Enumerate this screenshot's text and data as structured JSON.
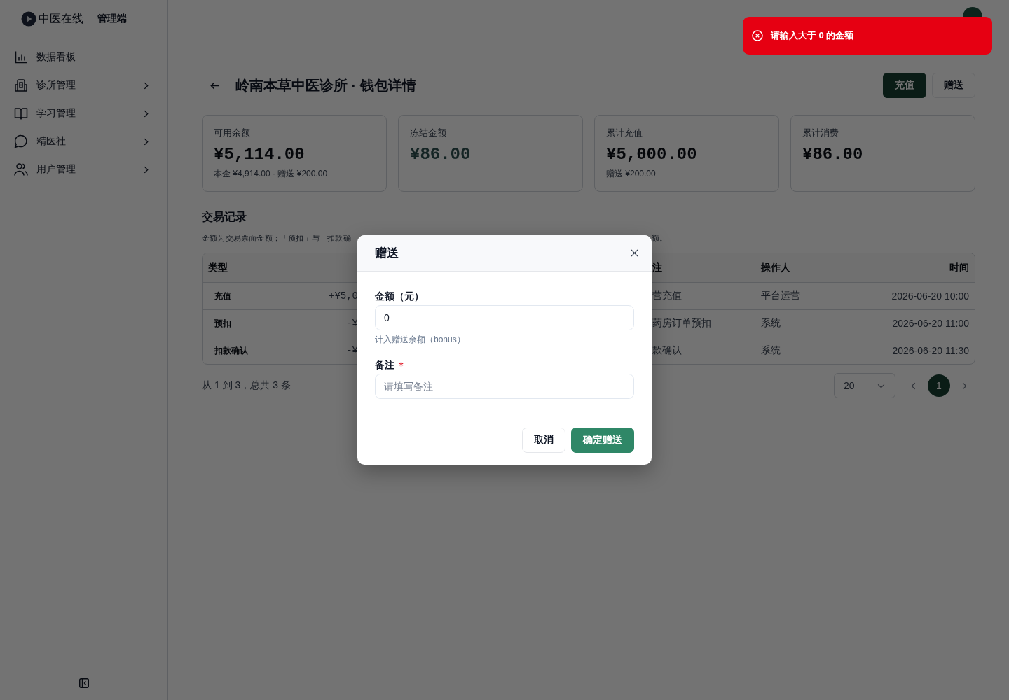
{
  "header": {
    "logo_text": "中医在线",
    "app_label": "管理端"
  },
  "sidebar": {
    "items": [
      {
        "label": "数据看板",
        "has_submenu": false
      },
      {
        "label": "诊所管理",
        "has_submenu": true
      },
      {
        "label": "学习管理",
        "has_submenu": true
      },
      {
        "label": "精医社",
        "has_submenu": true
      },
      {
        "label": "用户管理",
        "has_submenu": true
      }
    ]
  },
  "page": {
    "title": "岭南本草中医诊所 · 钱包详情",
    "actions": [
      {
        "label": "充值",
        "kind": "primary"
      },
      {
        "label": "赠送",
        "kind": "outline"
      }
    ]
  },
  "stats": [
    {
      "label": "可用余额",
      "value": "¥5,114.00",
      "note": "本金 ¥4,914.00 · 赠送 ¥200.00",
      "muted": false
    },
    {
      "label": "冻结金额",
      "value": "¥86.00",
      "muted": true
    },
    {
      "label": "累计充值",
      "value": "¥5,000.00",
      "note": "赠送 ¥200.00",
      "muted": false
    },
    {
      "label": "累计消费",
      "value": "¥86.00",
      "muted": false
    }
  ],
  "transactions": {
    "title": "交易记录",
    "note_left": "金额为交易票面金额；「预扣」与「扣款确",
    "note_right": "额。",
    "columns": {
      "type": "类型",
      "column_4": "注",
      "operator": "操作人",
      "time": "时间"
    },
    "rows": [
      {
        "type": "充值",
        "column_2": "+¥5,0",
        "column_4": "营充值",
        "operator": "平台运营",
        "time": "2026-06-20 10:00"
      },
      {
        "type": "预扣",
        "column_2": "-¥",
        "column_4": "药房订单预扣",
        "operator": "系统",
        "time": "2026-06-20 11:00"
      },
      {
        "type": "扣款确认",
        "column_2": "-¥",
        "column_4": "款确认",
        "operator": "系统",
        "time": "2026-06-20 11:30"
      }
    ]
  },
  "pagination": {
    "summary": "从 1 到 3，总共 3 条",
    "page_size": "20",
    "pages": [
      {
        "label": "1",
        "selected": true
      }
    ]
  },
  "modal": {
    "title": "赠送",
    "fields": [
      {
        "label": "金额（元）",
        "value": "0",
        "help": "计入赠送余额（bonus）",
        "required": false
      },
      {
        "label": "备注",
        "placeholder": "请填写备注",
        "required": true
      }
    ],
    "buttons": [
      {
        "label": "取消",
        "kind": "secondary"
      },
      {
        "label": "确定赠送",
        "kind": "primary"
      }
    ]
  },
  "toast": {
    "message": "请输入大于 0 的金额",
    "kind": "error"
  }
}
